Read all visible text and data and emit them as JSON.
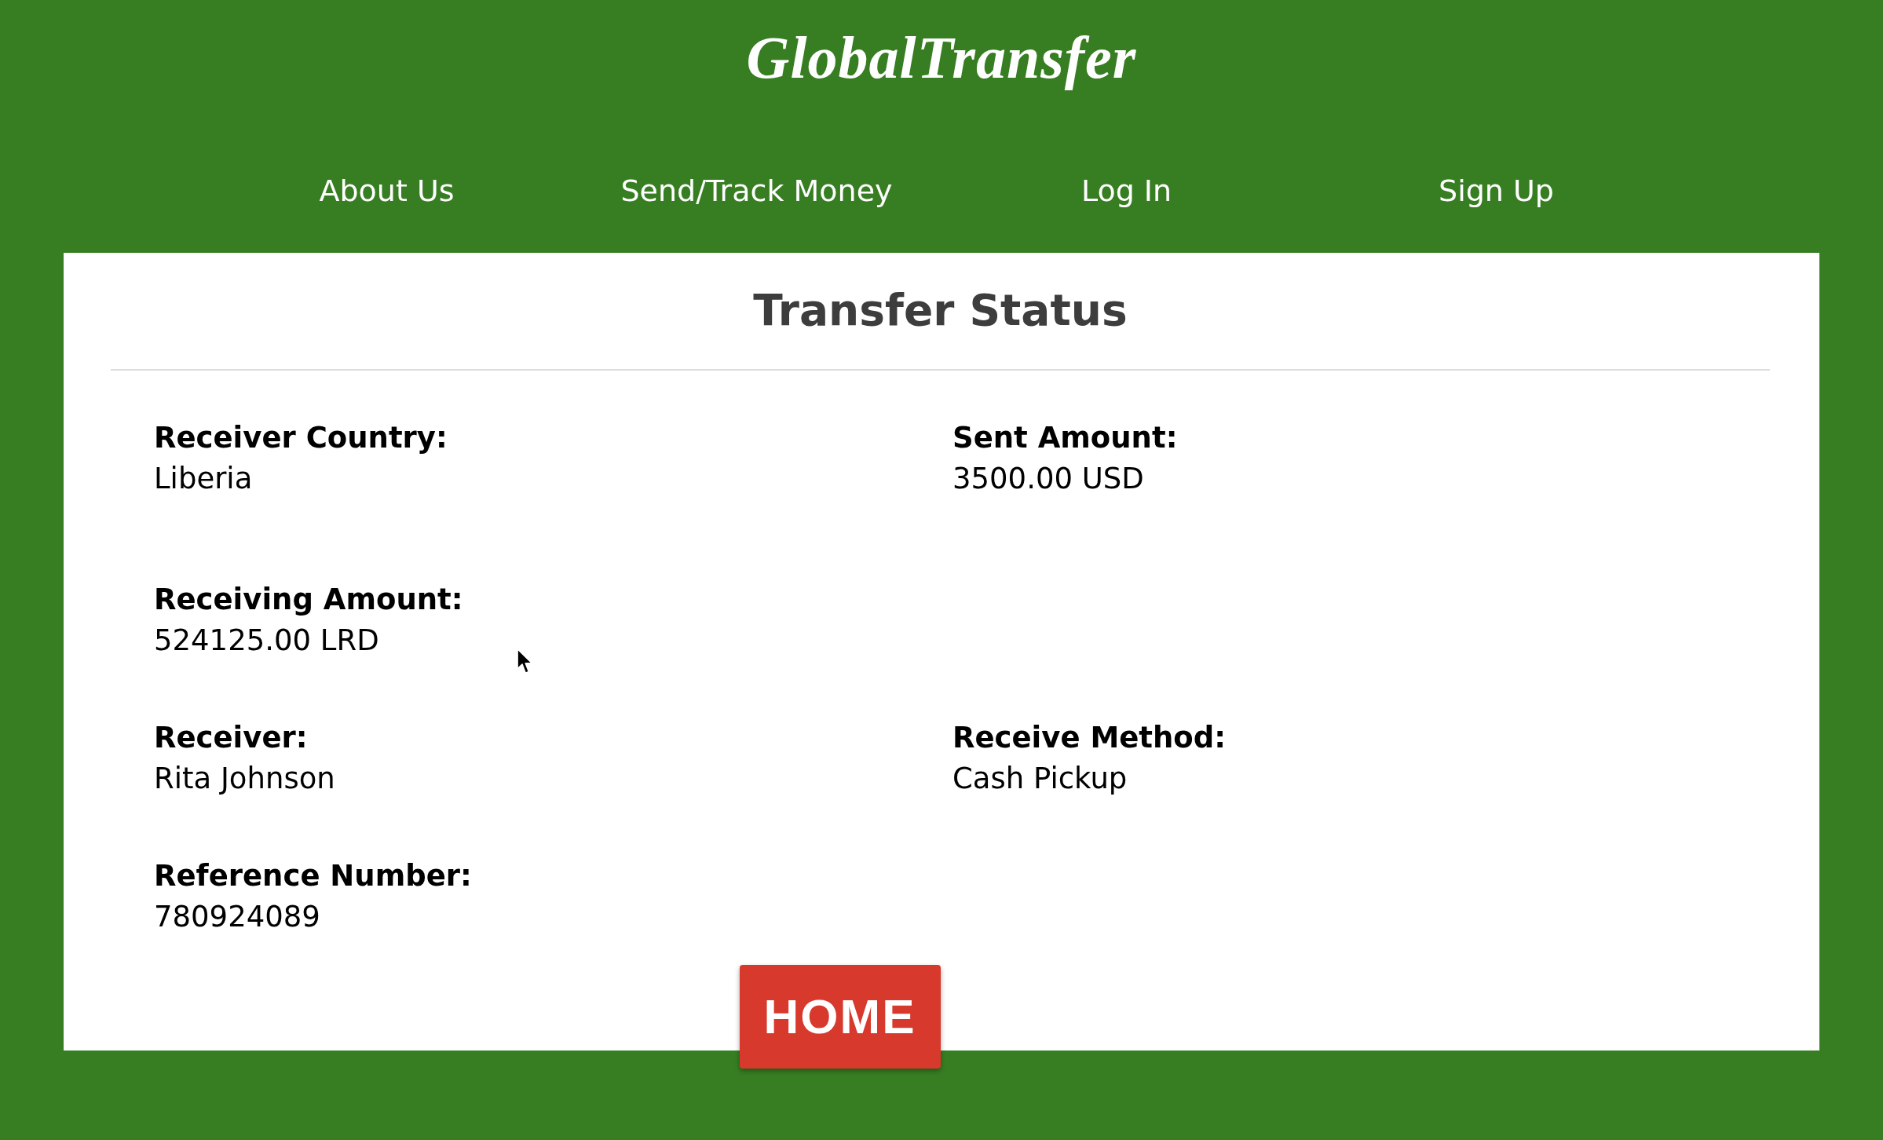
{
  "header": {
    "logo": "GlobalTransfer",
    "nav": [
      "About Us",
      "Send/Track Money",
      "Log In",
      "Sign Up"
    ]
  },
  "card": {
    "title": "Transfer Status",
    "rows": [
      [
        {
          "label": "Receiver Country:",
          "value": "Liberia"
        },
        {
          "label": "Sent Amount:",
          "value": "3500.00 USD"
        }
      ],
      [
        {
          "label": "Receiving Amount:",
          "value": "524125.00 LRD"
        }
      ],
      [
        {
          "label": "Receiver:",
          "value": "Rita Johnson"
        },
        {
          "label": "Receive Method:",
          "value": "Cash Pickup"
        }
      ],
      [
        {
          "label": "Reference Number:",
          "value": "780924089"
        }
      ]
    ],
    "button": "HOME"
  }
}
